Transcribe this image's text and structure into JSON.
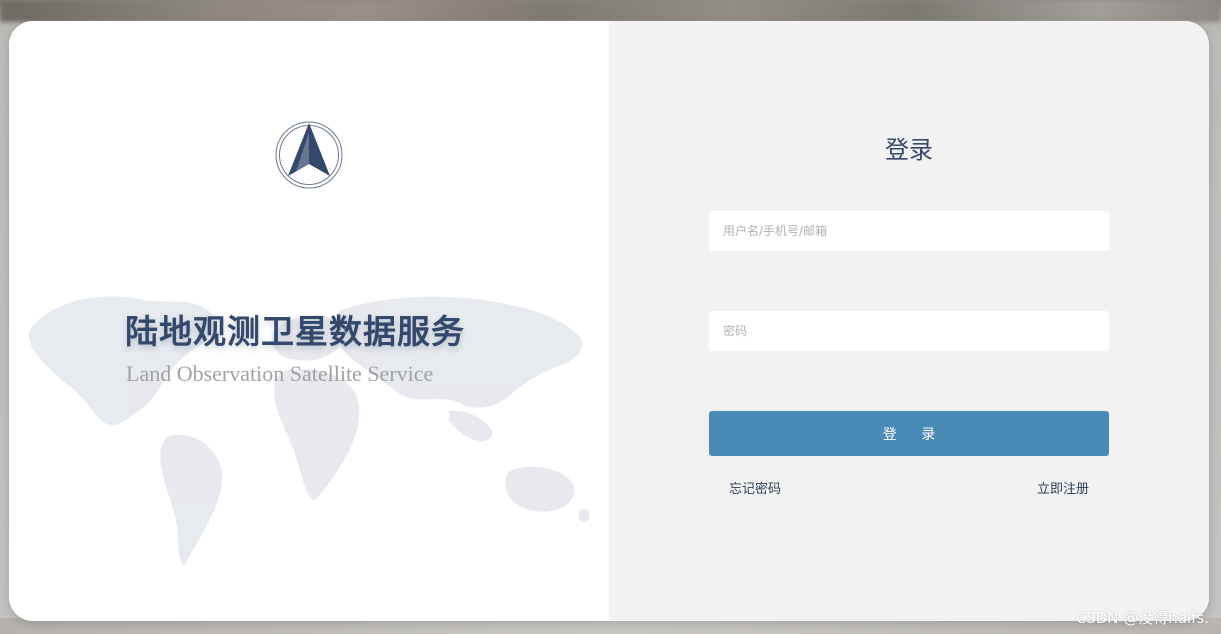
{
  "brand": {
    "title_cn": "陆地观测卫星数据服务",
    "title_en": "Land Observation Satellite Service",
    "logo_icon": "compass-arrow-icon"
  },
  "login": {
    "title": "登录",
    "username_placeholder": "用户名/手机号/邮箱",
    "username_value": "",
    "password_placeholder": "密码",
    "password_value": "",
    "submit_label": "登 录",
    "forgot_password": "忘记密码",
    "register": "立即注册"
  },
  "watermark": "CSDN @没得halfs.",
  "colors": {
    "accent": "#4a8ab6",
    "brand_text": "#34486c",
    "panel_bg": "#f2f2f2"
  }
}
